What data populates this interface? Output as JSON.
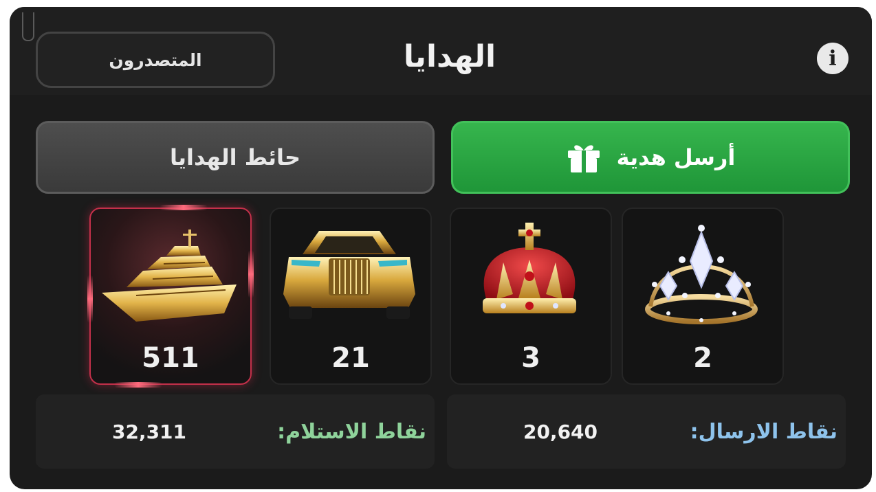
{
  "header": {
    "title": "الهدايا",
    "leaders_label": "المتصدرون",
    "info_icon": "info-icon"
  },
  "actions": {
    "send_gift_label": "أرسل هدية",
    "gift_wall_label": "حائط الهدايا"
  },
  "gifts": [
    {
      "name": "yacht-icon",
      "count": "511",
      "selected": true
    },
    {
      "name": "car-icon",
      "count": "21",
      "selected": false
    },
    {
      "name": "red-crown-icon",
      "count": "3",
      "selected": false
    },
    {
      "name": "tiara-icon",
      "count": "2",
      "selected": false
    }
  ],
  "stats": {
    "received_label": "نقاط الاستلام:",
    "received_value": "32,311",
    "sent_label": "نقاط الارسال:",
    "sent_value": "20,640"
  },
  "colors": {
    "panel_bg": "#1b1b1b",
    "send_button": "#2aa545",
    "selected_border": "#c4304a",
    "received_label": "#8fd39b",
    "sent_label": "#8ec3ec"
  }
}
